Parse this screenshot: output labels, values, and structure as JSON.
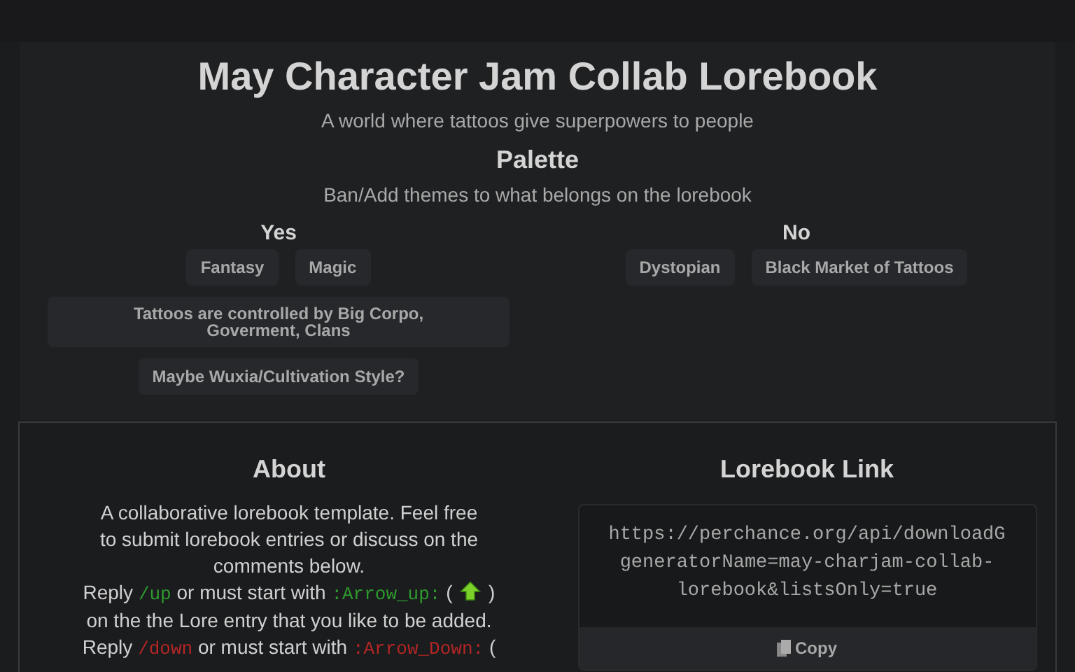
{
  "header": {
    "title": "May Character Jam Collab Lorebook",
    "subtitle": "A world where tattoos give superpowers to people"
  },
  "palette": {
    "title": "Palette",
    "description": "Ban/Add themes to what belongs on the lorebook",
    "columns": [
      {
        "heading": "Yes",
        "tags": [
          "Fantasy",
          "Magic",
          "Tattoos are controlled by Big Corpo, Goverment, Clans",
          "Maybe Wuxia/Cultivation Style?"
        ]
      },
      {
        "heading": "No",
        "tags": [
          "Dystopian",
          "Black Market of Tattoos"
        ]
      }
    ]
  },
  "about": {
    "title": "About",
    "segments": [
      {
        "kind": "text",
        "text": "A collaborative lorebook template. Feel free"
      },
      {
        "kind": "break"
      },
      {
        "kind": "text",
        "text": "to submit lorebook entries or discuss on the"
      },
      {
        "kind": "break"
      },
      {
        "kind": "text",
        "text": "comments below."
      },
      {
        "kind": "break"
      },
      {
        "kind": "text",
        "text": "Reply "
      },
      {
        "kind": "code",
        "text": "/up",
        "color": "#2e9a2e"
      },
      {
        "kind": "text",
        "text": " or must start with "
      },
      {
        "kind": "code",
        "text": ":Arrow_up:",
        "color": "#2e9a2e"
      },
      {
        "kind": "text",
        "text": " ( "
      },
      {
        "kind": "up-arrow"
      },
      {
        "kind": "text",
        "text": " )"
      },
      {
        "kind": "break"
      },
      {
        "kind": "text",
        "text": "on the the Lore entry that you like to be added."
      },
      {
        "kind": "break"
      },
      {
        "kind": "text",
        "text": "Reply "
      },
      {
        "kind": "code",
        "text": "/down",
        "color": "#b32626"
      },
      {
        "kind": "text",
        "text": " or must start with "
      },
      {
        "kind": "code",
        "text": ":Arrow_Down:",
        "color": "#b32626"
      },
      {
        "kind": "text",
        "text": " ("
      }
    ]
  },
  "link": {
    "title": "Lorebook Link",
    "lines": [
      "https://perchance.org/api/downloadG",
      "generatorName=may-charjam-collab-",
      "lorebook&listsOnly=true"
    ],
    "copy_label": "Copy"
  }
}
